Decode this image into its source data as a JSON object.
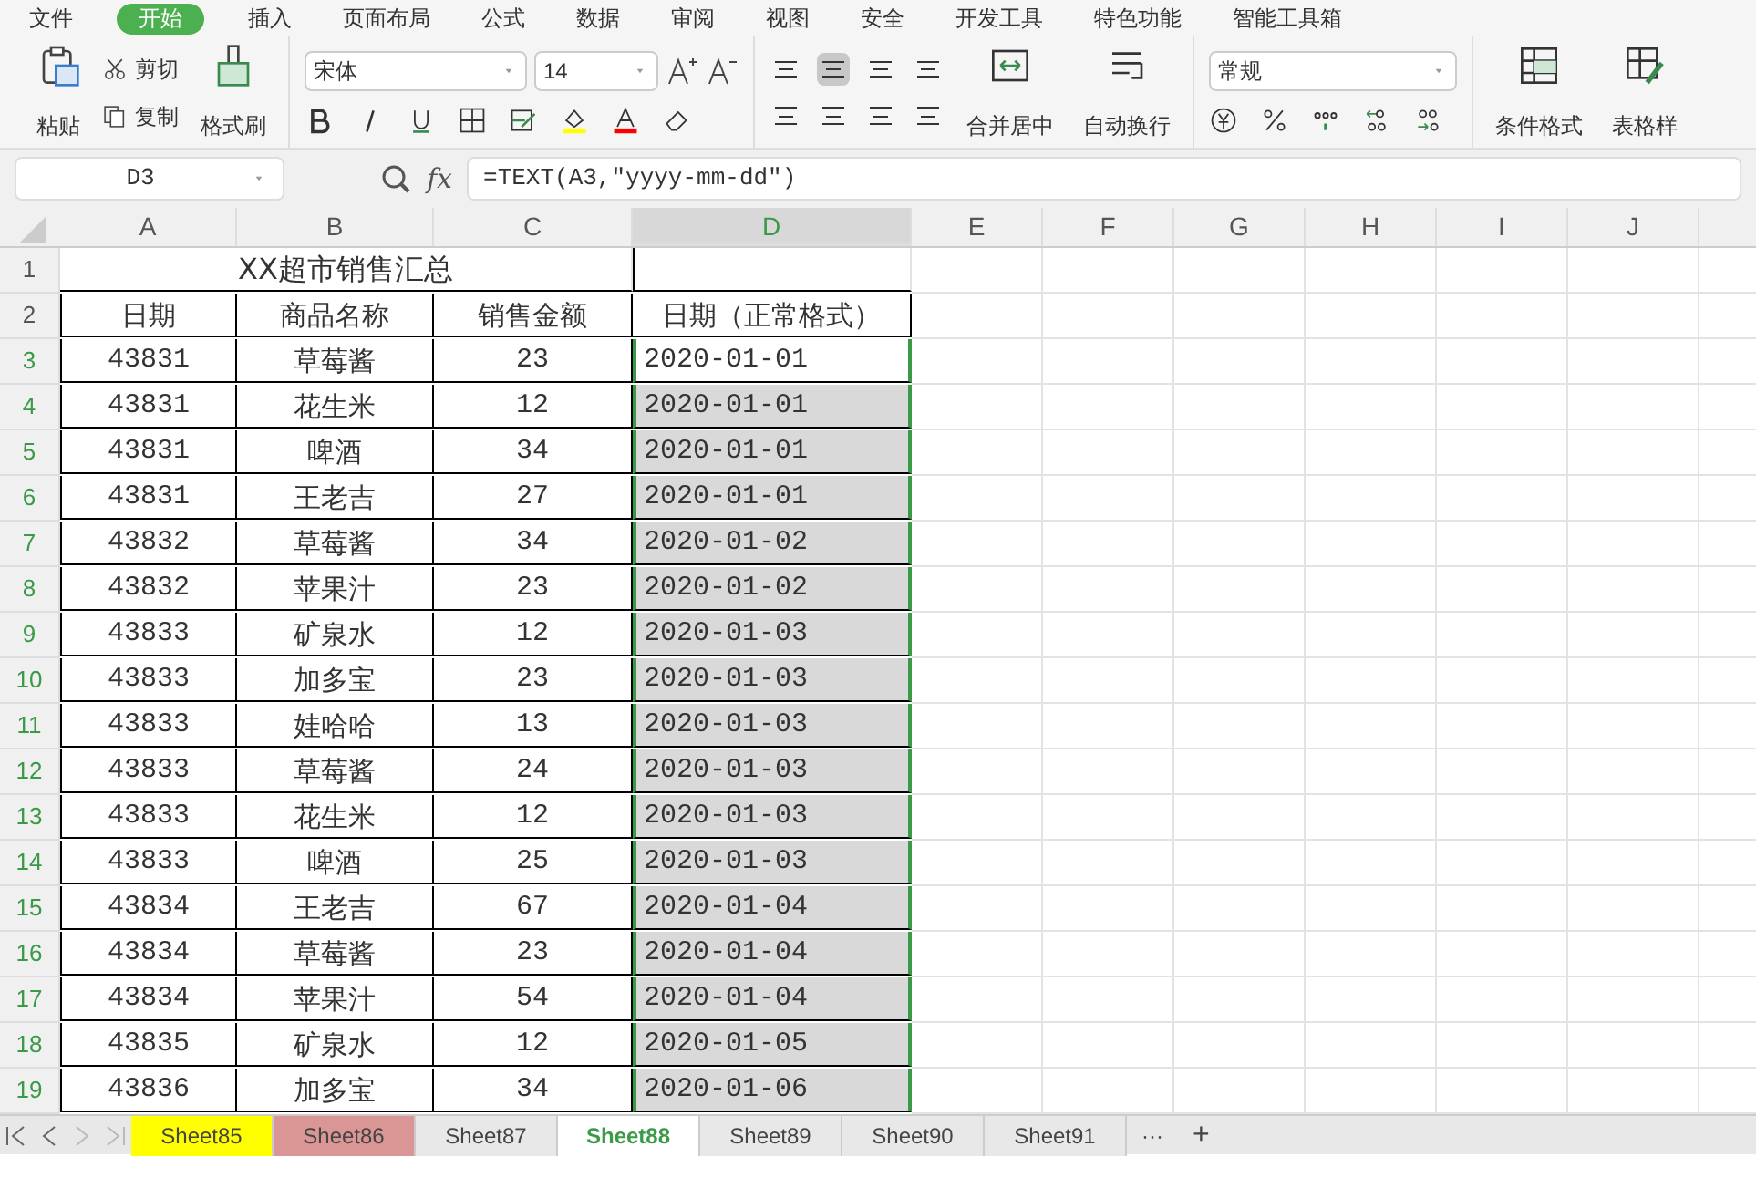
{
  "menu": [
    {
      "label": "文件",
      "selected": false
    },
    {
      "label": "开始",
      "selected": true
    },
    {
      "label": "插入",
      "selected": false
    },
    {
      "label": "页面布局",
      "selected": false
    },
    {
      "label": "公式",
      "selected": false
    },
    {
      "label": "数据",
      "selected": false
    },
    {
      "label": "审阅",
      "selected": false
    },
    {
      "label": "视图",
      "selected": false
    },
    {
      "label": "安全",
      "selected": false
    },
    {
      "label": "开发工具",
      "selected": false
    },
    {
      "label": "特色功能",
      "selected": false
    },
    {
      "label": "智能工具箱",
      "selected": false
    }
  ],
  "ribbon": {
    "paste": "粘贴",
    "cut": "剪切",
    "copy": "复制",
    "format_painter": "格式刷",
    "font": "宋体",
    "size": "14",
    "merge": "合并居中",
    "wrap": "自动换行",
    "number_format": "常规",
    "conditional": "条件格式",
    "table_style": "表格样"
  },
  "formula_bar": {
    "cell": "D3",
    "fx": "fx",
    "formula": "=TEXT(A3,\"yyyy-mm-dd\")"
  },
  "columns": [
    {
      "label": "A",
      "selected": false
    },
    {
      "label": "B",
      "selected": false
    },
    {
      "label": "C",
      "selected": false
    },
    {
      "label": "D",
      "selected": true
    },
    {
      "label": "E",
      "selected": false
    },
    {
      "label": "F",
      "selected": false
    },
    {
      "label": "G",
      "selected": false
    },
    {
      "label": "H",
      "selected": false
    },
    {
      "label": "I",
      "selected": false
    },
    {
      "label": "J",
      "selected": false
    }
  ],
  "title_row": "1",
  "header_row": "2",
  "title": "XX超市销售汇总",
  "headers": [
    "日期",
    "商品名称",
    "销售金额",
    "日期（正常格式）"
  ],
  "rows": [
    {
      "n": "3",
      "cells": [
        "43831",
        "草莓酱",
        "23",
        "2020-01-01"
      ]
    },
    {
      "n": "4",
      "cells": [
        "43831",
        "花生米",
        "12",
        "2020-01-01"
      ]
    },
    {
      "n": "5",
      "cells": [
        "43831",
        "啤酒",
        "34",
        "2020-01-01"
      ]
    },
    {
      "n": "6",
      "cells": [
        "43831",
        "王老吉",
        "27",
        "2020-01-01"
      ]
    },
    {
      "n": "7",
      "cells": [
        "43832",
        "草莓酱",
        "34",
        "2020-01-02"
      ]
    },
    {
      "n": "8",
      "cells": [
        "43832",
        "苹果汁",
        "23",
        "2020-01-02"
      ]
    },
    {
      "n": "9",
      "cells": [
        "43833",
        "矿泉水",
        "12",
        "2020-01-03"
      ]
    },
    {
      "n": "10",
      "cells": [
        "43833",
        "加多宝",
        "23",
        "2020-01-03"
      ]
    },
    {
      "n": "11",
      "cells": [
        "43833",
        "娃哈哈",
        "13",
        "2020-01-03"
      ]
    },
    {
      "n": "12",
      "cells": [
        "43833",
        "草莓酱",
        "24",
        "2020-01-03"
      ]
    },
    {
      "n": "13",
      "cells": [
        "43833",
        "花生米",
        "12",
        "2020-01-03"
      ]
    },
    {
      "n": "14",
      "cells": [
        "43833",
        "啤酒",
        "25",
        "2020-01-03"
      ]
    },
    {
      "n": "15",
      "cells": [
        "43834",
        "王老吉",
        "67",
        "2020-01-04"
      ]
    },
    {
      "n": "16",
      "cells": [
        "43834",
        "草莓酱",
        "23",
        "2020-01-04"
      ]
    },
    {
      "n": "17",
      "cells": [
        "43834",
        "苹果汁",
        "54",
        "2020-01-04"
      ]
    },
    {
      "n": "18",
      "cells": [
        "43835",
        "矿泉水",
        "12",
        "2020-01-05"
      ]
    },
    {
      "n": "19",
      "cells": [
        "43836",
        "加多宝",
        "34",
        "2020-01-06"
      ]
    }
  ],
  "sheets": [
    {
      "label": "Sheet85",
      "selected": false,
      "color": "#ffff00"
    },
    {
      "label": "Sheet86",
      "selected": false,
      "color": "#da9694"
    },
    {
      "label": "Sheet87",
      "selected": false,
      "color": "#e8e8e8"
    },
    {
      "label": "Sheet88",
      "selected": true,
      "color": "#ffffff"
    },
    {
      "label": "Sheet89",
      "selected": false,
      "color": "#e8e8e8"
    },
    {
      "label": "Sheet90",
      "selected": false,
      "color": "#e8e8e8"
    },
    {
      "label": "Sheet91",
      "selected": false,
      "color": "#e8e8e8"
    }
  ],
  "sheet_more": "···",
  "sheet_add": "+"
}
